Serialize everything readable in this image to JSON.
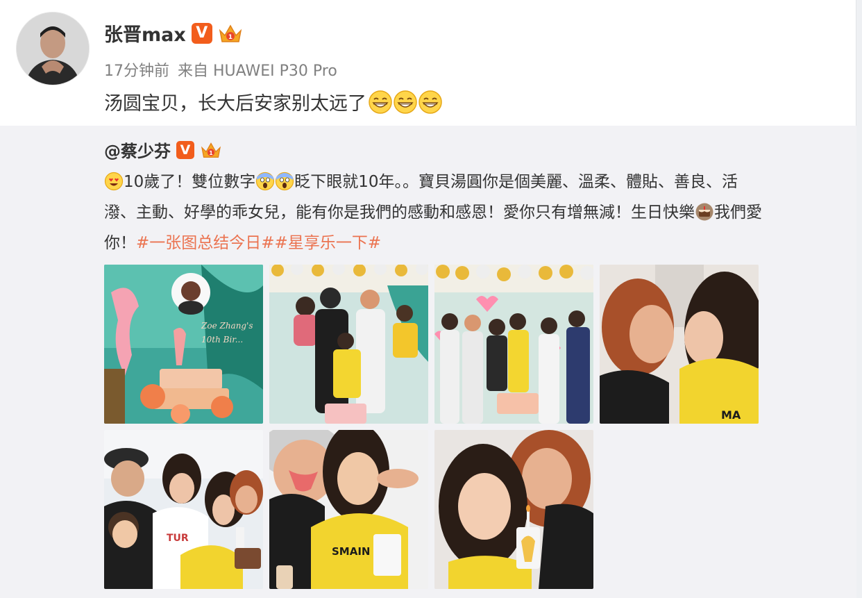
{
  "post": {
    "username": "张晋max",
    "verified_label": "V",
    "time": "17分钟前",
    "source": "来自 HUAWEI P30 Pro",
    "text": "汤圆宝贝，长大后安家别太远了"
  },
  "repost": {
    "author": "@蔡少芬",
    "verified_label": "V",
    "line1": "10歲了！雙位數字",
    "line1b": "眨下眼就10年。。寶貝湯圓你是個美麗、溫柔、體貼、善良、活",
    "line2a": "潑、主動、好學的乖女兒，能有你是我們的感動和感恩！愛你只有增無減！生日快樂",
    "line2b": "我們愛",
    "line3a": "你！",
    "hashtag1": "#一张图总结今日#",
    "hashtag2": "#星享乐一下#"
  },
  "images": [
    {
      "name": "photo-1"
    },
    {
      "name": "photo-2"
    },
    {
      "name": "photo-3"
    },
    {
      "name": "photo-4"
    },
    {
      "name": "photo-5"
    },
    {
      "name": "photo-6"
    },
    {
      "name": "photo-7"
    }
  ],
  "colors": {
    "hashtag": "#eb7350",
    "verified": "#f25d1c",
    "repost_bg": "#f2f2f5",
    "meta": "#808080"
  },
  "icons": {
    "verified": "verified-v-icon",
    "crown": "crown-icon",
    "grin": "grin-emoji-icon",
    "heart_eyes": "heart-eyes-emoji-icon",
    "scream": "scream-emoji-icon",
    "cake": "cake-emoji-icon"
  }
}
